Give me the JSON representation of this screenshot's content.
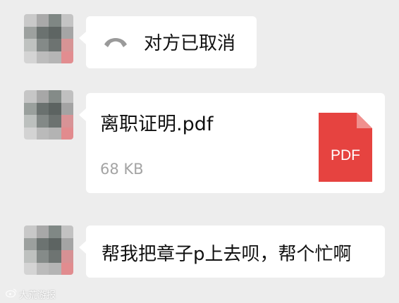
{
  "messages": [
    {
      "type": "call",
      "text": "对方已取消",
      "icon": "phone-hangup-icon"
    },
    {
      "type": "file",
      "file_name": "离职证明.pdf",
      "file_size": "68 KB",
      "file_type_label": "PDF",
      "icon": "pdf-file-icon"
    },
    {
      "type": "text",
      "text": "帮我把章子p上去呗，帮个忙啊"
    }
  ],
  "watermark": {
    "text": "大荒游报"
  },
  "colors": {
    "background": "#ededed",
    "bubble": "#ffffff",
    "pdf_red": "#e64340",
    "text": "#111111",
    "muted": "#a4a4a4"
  }
}
